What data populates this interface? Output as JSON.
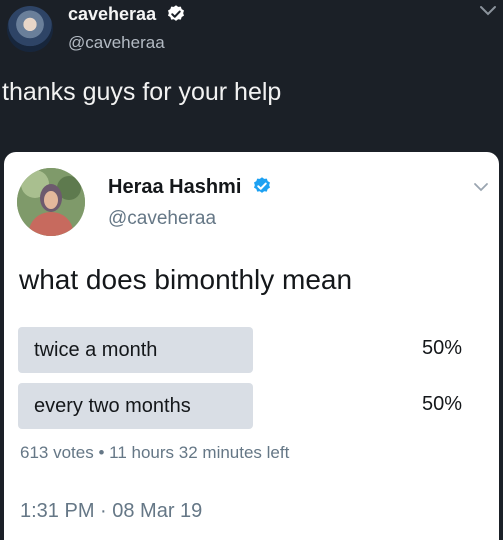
{
  "outer_tweet": {
    "name": "caveheraa",
    "handle": "@caveheraa",
    "text": "thanks guys for your help"
  },
  "quoted_tweet": {
    "name": "Heraa Hashmi",
    "handle": "@caveheraa",
    "question": "what does bimonthly mean",
    "poll": {
      "options": [
        {
          "label": "twice a month",
          "percent": "50%",
          "fraction": 0.5
        },
        {
          "label": "every two months",
          "percent": "50%",
          "fraction": 0.5
        }
      ],
      "votes": "613 votes",
      "separator": "•",
      "time_left": "11 hours 32 minutes left"
    },
    "timestamp": "1:31 PM · 08 Mar 19"
  },
  "colors": {
    "background": "#1b2027",
    "verified_blue": "#1da1f2",
    "poll_bar": "#d9dee5",
    "secondary_text": "#657786"
  },
  "icons": [
    "verified-badge-icon",
    "chevron-down-icon"
  ]
}
